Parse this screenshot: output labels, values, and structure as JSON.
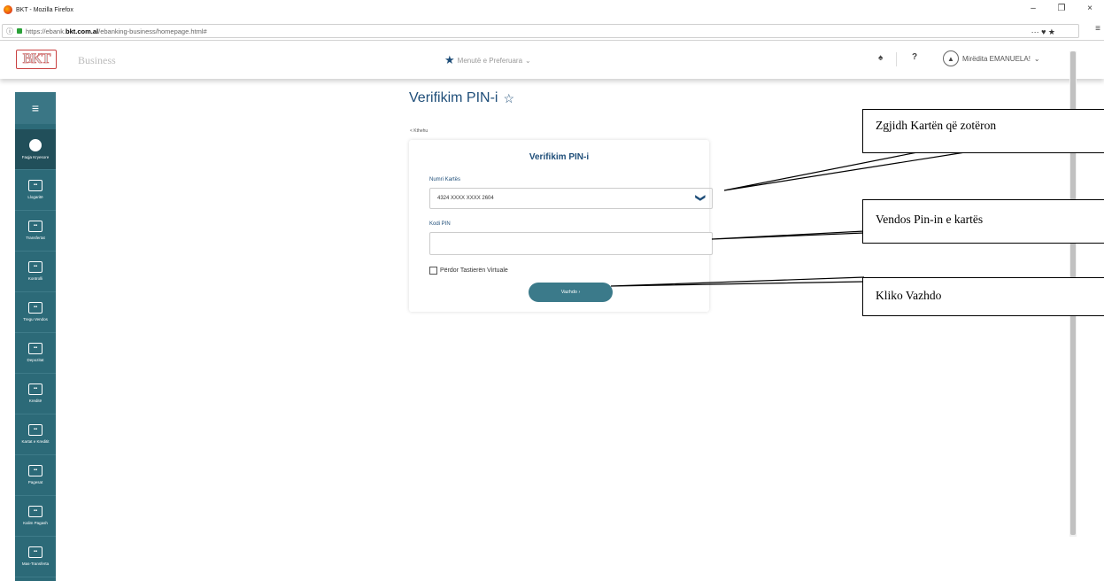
{
  "browser": {
    "window_title": "BKT - Mozilla Firefox",
    "url_prefix": "https://ebank.",
    "url_domain": "bkt.com.al",
    "url_path": "/ebanking-business/homepage.html#",
    "toolbar_icons": "··· ♥ ★",
    "menu_icon": "≡",
    "info_icon": "ⓘ",
    "minimize": "–",
    "restore": "❐",
    "close": "×"
  },
  "header": {
    "logo_text": "BKT",
    "business_label": "Business",
    "favorites_label": "Menutë e Preferuara",
    "favorites_chevron": "⌄",
    "bell_icon": "♠",
    "help_label": "?",
    "greeting": "Mirëdita EMANUELA!",
    "user_chevron": "⌄"
  },
  "sidebar": {
    "menu_icon": "≡",
    "items": [
      {
        "label": "Faqja Kryesore",
        "icon": "home-icon"
      },
      {
        "label": "Llogaritë",
        "icon": "accounts-icon"
      },
      {
        "label": "Transfertat",
        "icon": "transfer-icon"
      },
      {
        "label": "Kontrolli",
        "icon": "control-icon"
      },
      {
        "label": "Tregu Vendos",
        "icon": "market-icon"
      },
      {
        "label": "Depozitat",
        "icon": "deposit-icon"
      },
      {
        "label": "Kreditë",
        "icon": "credit-icon"
      },
      {
        "label": "Kartat e Kreditit",
        "icon": "card-icon"
      },
      {
        "label": "Pagesat",
        "icon": "payment-icon"
      },
      {
        "label": "Kalim Pagash",
        "icon": "payroll-icon"
      },
      {
        "label": "Mas-Transferta",
        "icon": "mass-transfer-icon"
      }
    ]
  },
  "main": {
    "title": "Verifikim PIN-i",
    "title_star": "☆",
    "back_link": "< Kthehu",
    "card_title": "Verifikim PIN-i",
    "card_label": "Numri Kartës",
    "card_value": "4324 XXXX XXXX 2604",
    "select_chevron": "❯",
    "pin_label": "Kodi PIN",
    "pin_value": "",
    "virtual_keyboard_label": "Përdor Tastierën Virtuale",
    "continue_button": "Vazhdo ›"
  },
  "callouts": {
    "select_card": "Zgjidh Kartën që zotëron",
    "enter_pin": "Vendos Pin-in e kartës",
    "click_continue": "Kliko Vazhdo"
  }
}
